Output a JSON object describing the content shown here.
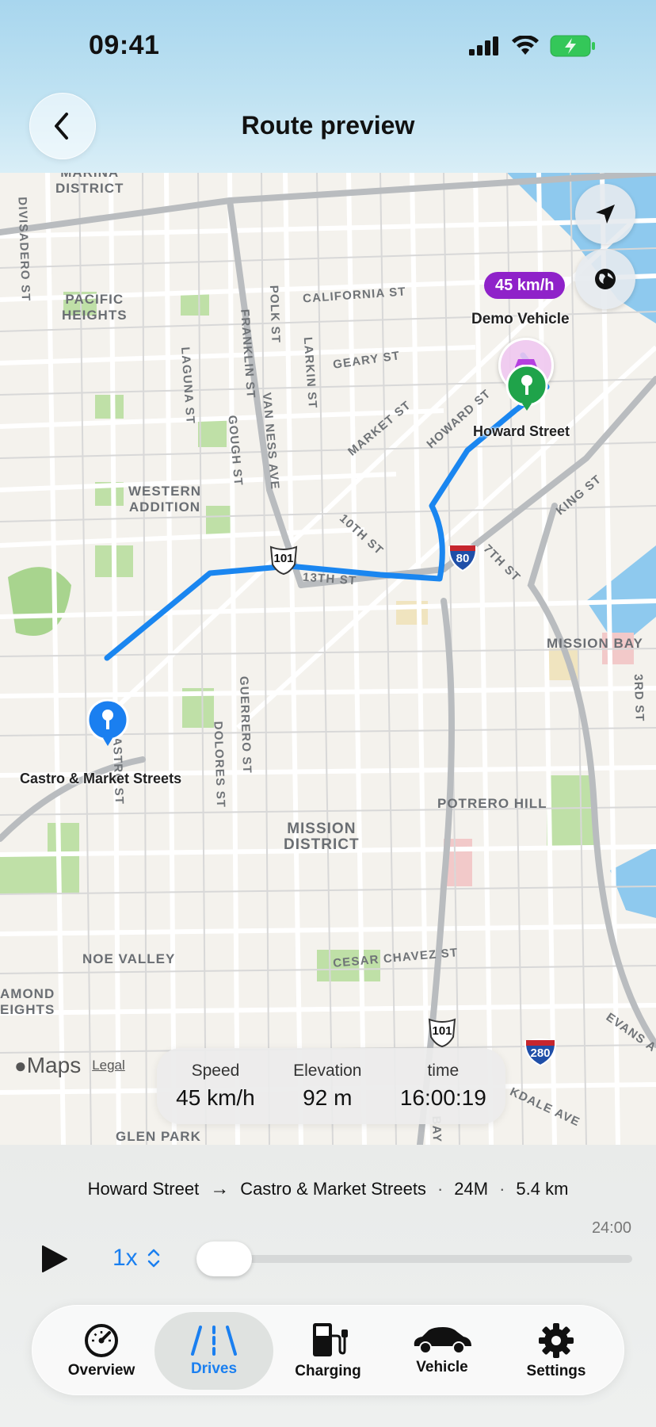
{
  "status_bar": {
    "time": "09:41"
  },
  "header": {
    "title": "Route preview"
  },
  "map": {
    "areas": [
      "MARINA\nDISTRICT",
      "PACIFIC\nHEIGHTS",
      "WESTERN\nADDITION",
      "MISSION\nDISTRICT",
      "NOE VALLEY",
      "POTRERO HILL",
      "MISSION BAY",
      "AMOND\nEIGHTS",
      "GLEN PARK"
    ],
    "streets": [
      "DIVISADERO ST",
      "POLK ST",
      "CALIFORNIA ST",
      "FRANKLIN ST",
      "LARKIN ST",
      "LAGUNA ST",
      "GEARY ST",
      "VAN NESS AVE",
      "GOUGH ST",
      "MARKET ST",
      "HOWARD ST",
      "KING ST",
      "10TH ST",
      "7TH ST",
      "13TH ST",
      "GUERRERO ST",
      "DOLORES ST",
      "CASTRO ST",
      "CESAR CHAVEZ ST",
      "3RD ST",
      "EVANS A",
      "KDALE AVE",
      "BAY"
    ],
    "shields": [
      "101",
      "80",
      "101",
      "280"
    ],
    "vehicle_speed": "45 km/h",
    "vehicle_name": "Demo Vehicle",
    "start_label": "Howard Street",
    "end_label": "Castro & Market Streets",
    "brand": "Maps",
    "legal": "Legal"
  },
  "stats": {
    "speed_label": "Speed",
    "speed_value": "45 km/h",
    "elevation_label": "Elevation",
    "elevation_value": "92 m",
    "time_label": "time",
    "time_value": "16:00:19"
  },
  "route": {
    "from": "Howard Street",
    "arrow": "→",
    "to": "Castro & Market Streets",
    "sep": "·",
    "duration_short": "24M",
    "distance": "5.4 km",
    "total_time": "24:00"
  },
  "playback": {
    "rate": "1x",
    "progress": 0.0
  },
  "tabs": [
    {
      "label": "Overview",
      "icon": "speedometer-icon"
    },
    {
      "label": "Drives",
      "icon": "road-icon"
    },
    {
      "label": "Charging",
      "icon": "fuel-charger-icon"
    },
    {
      "label": "Vehicle",
      "icon": "car-icon"
    },
    {
      "label": "Settings",
      "icon": "gear-icon"
    }
  ],
  "colors": {
    "accent": "#1a7ff0",
    "speed_pill": "#8f22c9",
    "route": "#1a86f0",
    "start_pin": "#1fa34a"
  }
}
